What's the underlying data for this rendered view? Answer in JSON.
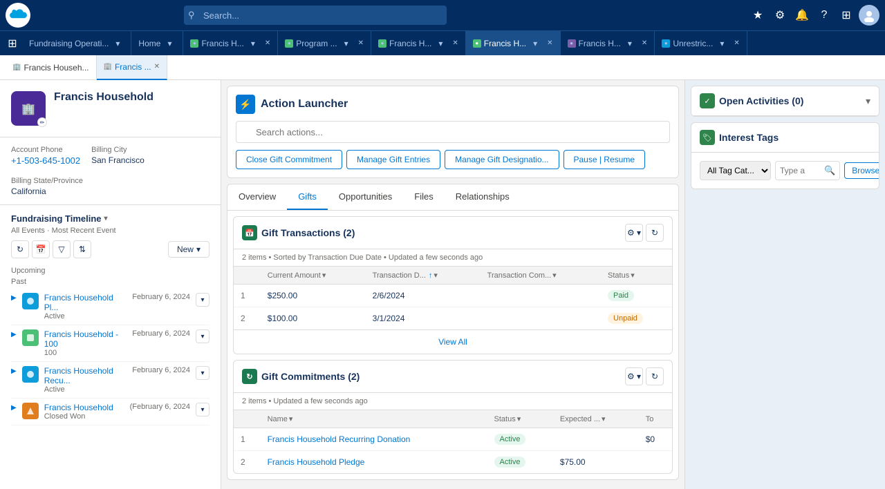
{
  "topNav": {
    "appTitle": "Fundraising Operati...",
    "searchPlaceholder": "Search...",
    "tabs": [
      {
        "label": "Home",
        "icon": "home",
        "active": false,
        "closable": false
      },
      {
        "label": "Francis H...",
        "icon": "person",
        "active": false,
        "closable": true,
        "dotColor": "#4bc076"
      },
      {
        "label": "Program ...",
        "icon": "grid",
        "active": false,
        "closable": true,
        "dotColor": "#4bc076"
      },
      {
        "label": "Francis H...",
        "icon": "person",
        "active": false,
        "closable": true,
        "dotColor": "#4bc076"
      },
      {
        "label": "Francis H...",
        "icon": "person",
        "active": true,
        "closable": true,
        "dotColor": "#4bc076"
      },
      {
        "label": "Francis H...",
        "icon": "person",
        "active": false,
        "closable": true,
        "dotColor": "#7b5ea7"
      },
      {
        "label": "Unrestric...",
        "icon": "grid",
        "active": false,
        "closable": true,
        "dotColor": "#0d9dda"
      }
    ]
  },
  "subTabs": [
    {
      "label": "Francis Househ...",
      "active": false,
      "closable": false
    },
    {
      "label": "Francis ...",
      "active": true,
      "closable": true
    }
  ],
  "account": {
    "name": "Francis Household",
    "phone_label": "Account Phone",
    "phone": "+1-503-645-1002",
    "billing_city_label": "Billing City",
    "billing_city": "San Francisco",
    "billing_state_label": "Billing State/Province",
    "billing_state": "California"
  },
  "timeline": {
    "title": "Fundraising Timeline",
    "subtitle": "All Events · Most Recent Event",
    "new_label": "New",
    "upcoming_label": "Upcoming",
    "past_label": "Past",
    "items": [
      {
        "title": "Francis Household Pl...",
        "subtitle": "Active",
        "date": "February 6, 2024",
        "color": "ti-blue"
      },
      {
        "title": "Francis Household - 100",
        "subtitle": "100",
        "date": "February 6, 2024",
        "color": "ti-green"
      },
      {
        "title": "Francis Household Recu...",
        "subtitle": "Active",
        "date": "February 6, 2024",
        "color": "ti-blue"
      },
      {
        "title": "Francis Household",
        "subtitle": "Closed Won",
        "date": "(February 6, 2024",
        "color": "ti-orange"
      }
    ]
  },
  "actionLauncher": {
    "title": "Action Launcher",
    "searchPlaceholder": "Search actions...",
    "buttons": [
      "Close Gift Commitment",
      "Manage Gift Entries",
      "Manage Gift Designatio...",
      "Pause | Resume"
    ]
  },
  "recordTabs": [
    {
      "label": "Overview",
      "active": false
    },
    {
      "label": "Gifts",
      "active": true
    },
    {
      "label": "Opportunities",
      "active": false
    },
    {
      "label": "Files",
      "active": false
    },
    {
      "label": "Relationships",
      "active": false
    }
  ],
  "giftTransactions": {
    "title": "Gift Transactions (2)",
    "count": "2",
    "subtitle": "2 items • Sorted by Transaction Due Date • Updated a few seconds ago",
    "columns": [
      "",
      "Current Amount",
      "Transaction D...",
      "Transaction Com...",
      "Status"
    ],
    "rows": [
      {
        "num": "1",
        "current_amount": "$250.00",
        "transaction_date": "2/6/2024",
        "transaction_com": "",
        "status": "Paid"
      },
      {
        "num": "2",
        "current_amount": "$100.00",
        "transaction_date": "3/1/2024",
        "transaction_com": "",
        "status": "Unpaid"
      }
    ],
    "view_all": "View All"
  },
  "giftCommitments": {
    "title": "Gift Commitments (2)",
    "count": "2",
    "subtitle": "2 items • Updated a few seconds ago",
    "columns": [
      "",
      "Name",
      "Status",
      "Expected ...",
      "To"
    ],
    "rows": [
      {
        "num": "1",
        "name": "Francis Household Recurring Donation",
        "status": "Active",
        "expected": "",
        "to": "$0"
      },
      {
        "num": "2",
        "name": "Francis Household Pledge",
        "status": "Active",
        "expected": "$75.00",
        "to": ""
      }
    ]
  },
  "rightPanel": {
    "openActivities": {
      "title": "Open Activities (0)",
      "count": "0"
    },
    "interestTags": {
      "title": "Interest Tags",
      "tag_category_placeholder": "All Tag Cat...",
      "tag_search_placeholder": "Type a",
      "browse_tags_label": "Browse Tags"
    }
  }
}
